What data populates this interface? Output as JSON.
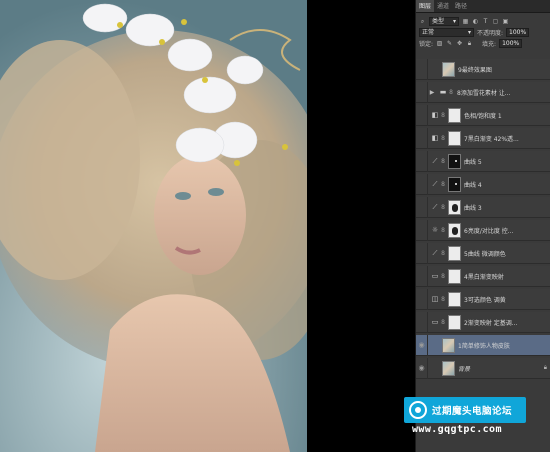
{
  "panel": {
    "tabs": [
      "图层",
      "通道",
      "路径"
    ],
    "filter": {
      "kind": "类型"
    },
    "blend_mode": "正常",
    "opacity_label": "不透明度:",
    "opacity_value": "100%",
    "lock_label": "锁定:",
    "fill_label": "填充:",
    "fill_value": "100%",
    "layers": [
      {
        "name": "9最终效果图",
        "kind": "pixel",
        "visible": false,
        "thumb": "photo"
      },
      {
        "name": "8添加雪花素材 让...",
        "kind": "group",
        "visible": false,
        "thumb": "folder"
      },
      {
        "name": "色相/饱和度 1",
        "kind": "adjust",
        "visible": false,
        "thumb": "white"
      },
      {
        "name": "7黑白渐变 42%透...",
        "kind": "adjust",
        "visible": false,
        "thumb": "white"
      },
      {
        "name": "曲线 5",
        "kind": "curves",
        "visible": false,
        "thumb": "dark-dot"
      },
      {
        "name": "曲线 4",
        "kind": "curves",
        "visible": false,
        "thumb": "dark-dot"
      },
      {
        "name": "曲线 3",
        "kind": "curves",
        "visible": false,
        "thumb": "blob"
      },
      {
        "name": "6亮度/对比度 控...",
        "kind": "brightness",
        "visible": false,
        "thumb": "blob"
      },
      {
        "name": "5曲线 微调颜色",
        "kind": "curves",
        "visible": false,
        "thumb": "white"
      },
      {
        "name": "4黑白渐变映射",
        "kind": "gradient",
        "visible": false,
        "thumb": "white"
      },
      {
        "name": "3可选颜色 调黄",
        "kind": "selective",
        "visible": false,
        "thumb": "white"
      },
      {
        "name": "2渐变映射 定基调...",
        "kind": "gradient",
        "visible": false,
        "thumb": "white"
      },
      {
        "name": "1简单修饰人物皮肤",
        "kind": "pixel",
        "visible": true,
        "selected": true,
        "thumb": "photo"
      },
      {
        "name": "背景",
        "kind": "pixel",
        "visible": true,
        "thumb": "photo",
        "locked": true
      }
    ]
  },
  "watermark": {
    "title": "过期魔头电脑论坛",
    "url": "www.gqgtpc.com"
  },
  "icons": {
    "eye": "eye-icon",
    "group": "folder-icon",
    "adjust": "adjustment-icon",
    "curves": "curves-icon",
    "brightness": "sun-icon",
    "gradient": "gradient-map-icon",
    "selective": "selective-color-icon",
    "lock": "lock-icon"
  },
  "colors": {
    "panel_bg": "#3a3a3a",
    "selected_layer": "#5a6b86",
    "watermark_bg": "#10a6d9"
  }
}
